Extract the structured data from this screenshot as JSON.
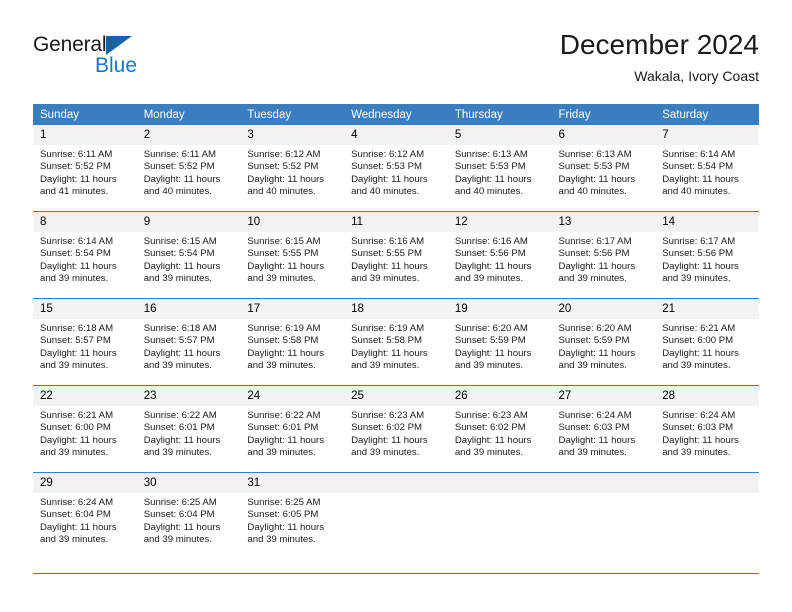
{
  "brand": {
    "name_part1": "General",
    "name_part2": "Blue",
    "triangle_color": "#1464a5",
    "blue_color": "#1477c9"
  },
  "header": {
    "title": "December 2024",
    "subtitle": "Wakala, Ivory Coast"
  },
  "colors": {
    "header_blue": "#3a7ebf",
    "daynum_background": "#f2f2f2",
    "text": "#1a1a1a"
  },
  "weekday_headers": [
    "Sunday",
    "Monday",
    "Tuesday",
    "Wednesday",
    "Thursday",
    "Friday",
    "Saturday"
  ],
  "weeks": [
    [
      {
        "day": "1",
        "sunrise": "Sunrise: 6:11 AM",
        "sunset": "Sunset: 5:52 PM",
        "daylight_line1": "Daylight: 11 hours",
        "daylight_line2": "and 41 minutes."
      },
      {
        "day": "2",
        "sunrise": "Sunrise: 6:11 AM",
        "sunset": "Sunset: 5:52 PM",
        "daylight_line1": "Daylight: 11 hours",
        "daylight_line2": "and 40 minutes."
      },
      {
        "day": "3",
        "sunrise": "Sunrise: 6:12 AM",
        "sunset": "Sunset: 5:52 PM",
        "daylight_line1": "Daylight: 11 hours",
        "daylight_line2": "and 40 minutes."
      },
      {
        "day": "4",
        "sunrise": "Sunrise: 6:12 AM",
        "sunset": "Sunset: 5:53 PM",
        "daylight_line1": "Daylight: 11 hours",
        "daylight_line2": "and 40 minutes."
      },
      {
        "day": "5",
        "sunrise": "Sunrise: 6:13 AM",
        "sunset": "Sunset: 5:53 PM",
        "daylight_line1": "Daylight: 11 hours",
        "daylight_line2": "and 40 minutes."
      },
      {
        "day": "6",
        "sunrise": "Sunrise: 6:13 AM",
        "sunset": "Sunset: 5:53 PM",
        "daylight_line1": "Daylight: 11 hours",
        "daylight_line2": "and 40 minutes."
      },
      {
        "day": "7",
        "sunrise": "Sunrise: 6:14 AM",
        "sunset": "Sunset: 5:54 PM",
        "daylight_line1": "Daylight: 11 hours",
        "daylight_line2": "and 40 minutes."
      }
    ],
    [
      {
        "day": "8",
        "sunrise": "Sunrise: 6:14 AM",
        "sunset": "Sunset: 5:54 PM",
        "daylight_line1": "Daylight: 11 hours",
        "daylight_line2": "and 39 minutes."
      },
      {
        "day": "9",
        "sunrise": "Sunrise: 6:15 AM",
        "sunset": "Sunset: 5:54 PM",
        "daylight_line1": "Daylight: 11 hours",
        "daylight_line2": "and 39 minutes."
      },
      {
        "day": "10",
        "sunrise": "Sunrise: 6:15 AM",
        "sunset": "Sunset: 5:55 PM",
        "daylight_line1": "Daylight: 11 hours",
        "daylight_line2": "and 39 minutes."
      },
      {
        "day": "11",
        "sunrise": "Sunrise: 6:16 AM",
        "sunset": "Sunset: 5:55 PM",
        "daylight_line1": "Daylight: 11 hours",
        "daylight_line2": "and 39 minutes."
      },
      {
        "day": "12",
        "sunrise": "Sunrise: 6:16 AM",
        "sunset": "Sunset: 5:56 PM",
        "daylight_line1": "Daylight: 11 hours",
        "daylight_line2": "and 39 minutes."
      },
      {
        "day": "13",
        "sunrise": "Sunrise: 6:17 AM",
        "sunset": "Sunset: 5:56 PM",
        "daylight_line1": "Daylight: 11 hours",
        "daylight_line2": "and 39 minutes."
      },
      {
        "day": "14",
        "sunrise": "Sunrise: 6:17 AM",
        "sunset": "Sunset: 5:56 PM",
        "daylight_line1": "Daylight: 11 hours",
        "daylight_line2": "and 39 minutes."
      }
    ],
    [
      {
        "day": "15",
        "sunrise": "Sunrise: 6:18 AM",
        "sunset": "Sunset: 5:57 PM",
        "daylight_line1": "Daylight: 11 hours",
        "daylight_line2": "and 39 minutes."
      },
      {
        "day": "16",
        "sunrise": "Sunrise: 6:18 AM",
        "sunset": "Sunset: 5:57 PM",
        "daylight_line1": "Daylight: 11 hours",
        "daylight_line2": "and 39 minutes."
      },
      {
        "day": "17",
        "sunrise": "Sunrise: 6:19 AM",
        "sunset": "Sunset: 5:58 PM",
        "daylight_line1": "Daylight: 11 hours",
        "daylight_line2": "and 39 minutes."
      },
      {
        "day": "18",
        "sunrise": "Sunrise: 6:19 AM",
        "sunset": "Sunset: 5:58 PM",
        "daylight_line1": "Daylight: 11 hours",
        "daylight_line2": "and 39 minutes."
      },
      {
        "day": "19",
        "sunrise": "Sunrise: 6:20 AM",
        "sunset": "Sunset: 5:59 PM",
        "daylight_line1": "Daylight: 11 hours",
        "daylight_line2": "and 39 minutes."
      },
      {
        "day": "20",
        "sunrise": "Sunrise: 6:20 AM",
        "sunset": "Sunset: 5:59 PM",
        "daylight_line1": "Daylight: 11 hours",
        "daylight_line2": "and 39 minutes."
      },
      {
        "day": "21",
        "sunrise": "Sunrise: 6:21 AM",
        "sunset": "Sunset: 6:00 PM",
        "daylight_line1": "Daylight: 11 hours",
        "daylight_line2": "and 39 minutes."
      }
    ],
    [
      {
        "day": "22",
        "sunrise": "Sunrise: 6:21 AM",
        "sunset": "Sunset: 6:00 PM",
        "daylight_line1": "Daylight: 11 hours",
        "daylight_line2": "and 39 minutes."
      },
      {
        "day": "23",
        "sunrise": "Sunrise: 6:22 AM",
        "sunset": "Sunset: 6:01 PM",
        "daylight_line1": "Daylight: 11 hours",
        "daylight_line2": "and 39 minutes."
      },
      {
        "day": "24",
        "sunrise": "Sunrise: 6:22 AM",
        "sunset": "Sunset: 6:01 PM",
        "daylight_line1": "Daylight: 11 hours",
        "daylight_line2": "and 39 minutes."
      },
      {
        "day": "25",
        "sunrise": "Sunrise: 6:23 AM",
        "sunset": "Sunset: 6:02 PM",
        "daylight_line1": "Daylight: 11 hours",
        "daylight_line2": "and 39 minutes."
      },
      {
        "day": "26",
        "sunrise": "Sunrise: 6:23 AM",
        "sunset": "Sunset: 6:02 PM",
        "daylight_line1": "Daylight: 11 hours",
        "daylight_line2": "and 39 minutes."
      },
      {
        "day": "27",
        "sunrise": "Sunrise: 6:24 AM",
        "sunset": "Sunset: 6:03 PM",
        "daylight_line1": "Daylight: 11 hours",
        "daylight_line2": "and 39 minutes."
      },
      {
        "day": "28",
        "sunrise": "Sunrise: 6:24 AM",
        "sunset": "Sunset: 6:03 PM",
        "daylight_line1": "Daylight: 11 hours",
        "daylight_line2": "and 39 minutes."
      }
    ],
    [
      {
        "day": "29",
        "sunrise": "Sunrise: 6:24 AM",
        "sunset": "Sunset: 6:04 PM",
        "daylight_line1": "Daylight: 11 hours",
        "daylight_line2": "and 39 minutes."
      },
      {
        "day": "30",
        "sunrise": "Sunrise: 6:25 AM",
        "sunset": "Sunset: 6:04 PM",
        "daylight_line1": "Daylight: 11 hours",
        "daylight_line2": "and 39 minutes."
      },
      {
        "day": "31",
        "sunrise": "Sunrise: 6:25 AM",
        "sunset": "Sunset: 6:05 PM",
        "daylight_line1": "Daylight: 11 hours",
        "daylight_line2": "and 39 minutes."
      },
      {
        "day": "",
        "sunrise": "",
        "sunset": "",
        "daylight_line1": "",
        "daylight_line2": ""
      },
      {
        "day": "",
        "sunrise": "",
        "sunset": "",
        "daylight_line1": "",
        "daylight_line2": ""
      },
      {
        "day": "",
        "sunrise": "",
        "sunset": "",
        "daylight_line1": "",
        "daylight_line2": ""
      },
      {
        "day": "",
        "sunrise": "",
        "sunset": "",
        "daylight_line1": "",
        "daylight_line2": ""
      }
    ]
  ]
}
